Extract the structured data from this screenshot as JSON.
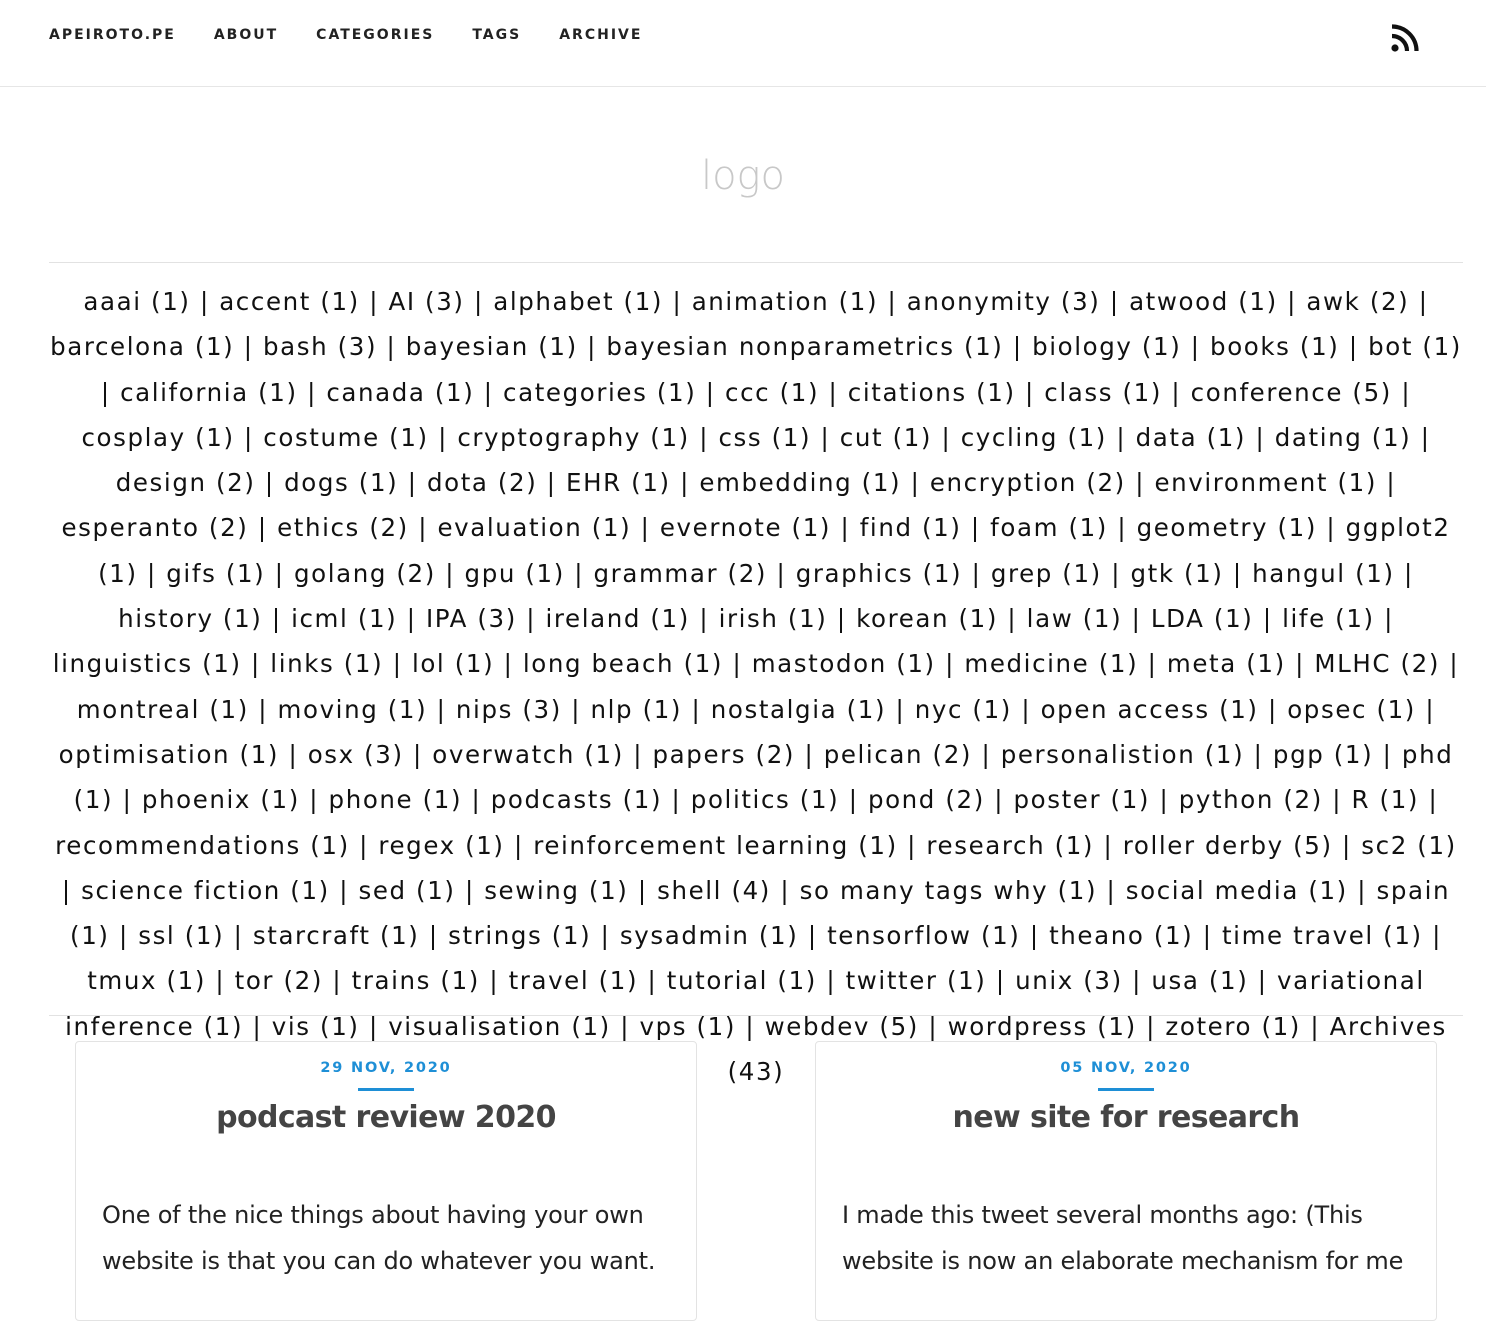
{
  "nav": {
    "items": [
      {
        "label": "APEIROTO.PE"
      },
      {
        "label": "ABOUT"
      },
      {
        "label": "CATEGORIES"
      },
      {
        "label": "TAGS"
      },
      {
        "label": "ARCHIVE"
      }
    ],
    "feed_icon": "rss-icon"
  },
  "logo": {
    "text": "logo"
  },
  "tags": [
    "aaai (1)",
    "accent (1)",
    "AI (3)",
    "alphabet (1)",
    "animation (1)",
    "anonymity (3)",
    "atwood (1)",
    "awk (2)",
    "barcelona (1)",
    "bash (3)",
    "bayesian (1)",
    "bayesian nonparametrics (1)",
    "biology (1)",
    "books (1)",
    "bot (1)",
    "california (1)",
    "canada (1)",
    "categories (1)",
    "ccc (1)",
    "citations (1)",
    "class (1)",
    "conference (5)",
    "cosplay (1)",
    "costume (1)",
    "cryptography (1)",
    "css (1)",
    "cut (1)",
    "cycling (1)",
    "data (1)",
    "dating (1)",
    "design (2)",
    "dogs (1)",
    "dota (2)",
    "EHR (1)",
    "embedding (1)",
    "encryption (2)",
    "environment (1)",
    "esperanto (2)",
    "ethics (2)",
    "evaluation (1)",
    "evernote (1)",
    "find (1)",
    "foam (1)",
    "geometry (1)",
    "ggplot2 (1)",
    "gifs (1)",
    "golang (2)",
    "gpu (1)",
    "grammar (2)",
    "graphics (1)",
    "grep (1)",
    "gtk (1)",
    "hangul (1)",
    "history (1)",
    "icml (1)",
    "IPA (3)",
    "ireland (1)",
    "irish (1)",
    "korean (1)",
    "law (1)",
    "LDA (1)",
    "life (1)",
    "linguistics (1)",
    "links (1)",
    "lol (1)",
    "long beach (1)",
    "mastodon (1)",
    "medicine (1)",
    "meta (1)",
    "MLHC (2)",
    "montreal (1)",
    "moving (1)",
    "nips (3)",
    "nlp (1)",
    "nostalgia (1)",
    "nyc (1)",
    "open access (1)",
    "opsec (1)",
    "optimisation (1)",
    "osx (3)",
    "overwatch (1)",
    "papers (2)",
    "pelican (2)",
    "personalistion (1)",
    "pgp (1)",
    "phd (1)",
    "phoenix (1)",
    "phone (1)",
    "podcasts (1)",
    "politics (1)",
    "pond (2)",
    "poster (1)",
    "python (2)",
    "R (1)",
    "recommendations (1)",
    "regex (1)",
    "reinforcement learning (1)",
    "research (1)",
    "roller derby (5)",
    "sc2 (1)",
    "science fiction (1)",
    "sed (1)",
    "sewing (1)",
    "shell (4)",
    "so many tags why (1)",
    "social media (1)",
    "spain (1)",
    "ssl (1)",
    "starcraft (1)",
    "strings (1)",
    "sysadmin (1)",
    "tensorflow (1)",
    "theano (1)",
    "time travel (1)",
    "tmux (1)",
    "tor (2)",
    "trains (1)",
    "travel (1)",
    "tutorial (1)",
    "twitter (1)",
    "unix (3)",
    "usa (1)",
    "variational inference (1)",
    "vis (1)",
    "visualisation (1)",
    "vps (1)",
    "webdev (5)",
    "wordpress (1)",
    "zotero (1)",
    "Archives (43)"
  ],
  "posts": [
    {
      "date": "29 NOV, 2020",
      "title": "podcast review 2020",
      "excerpt": "One of the nice things about having your own website is that you can do whatever you want."
    },
    {
      "date": "05 NOV, 2020",
      "title": "new site for research",
      "excerpt": "I made this tweet several months ago: (This website is now an elaborate mechanism for me"
    }
  ]
}
